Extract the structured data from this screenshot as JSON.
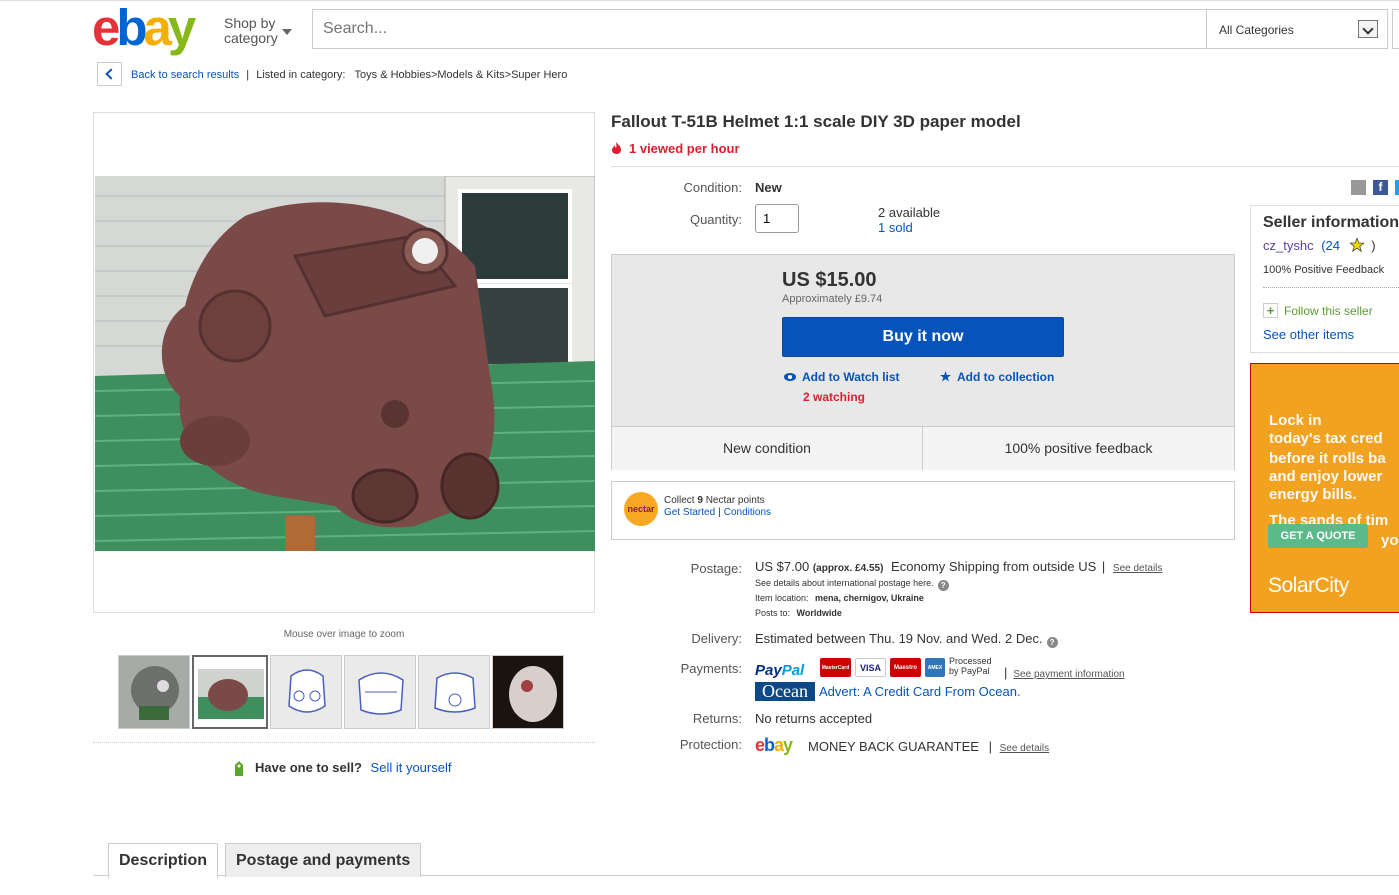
{
  "header": {
    "logo": {
      "e": "e",
      "b": "b",
      "a": "a",
      "y": "y"
    },
    "shop_by_line1": "Shop by",
    "shop_by_line2": "category",
    "search_placeholder": "Search...",
    "category_select": "All Categories"
  },
  "breadcrumb": {
    "back_label": "Back to search results",
    "sep": "|",
    "listed_label": "Listed in category:",
    "path": "Toys & Hobbies>Models & Kits>Super Hero"
  },
  "gallery": {
    "zoom_hint": "Mouse over image to zoom",
    "sell_question": "Have one to sell?",
    "sell_link": "Sell it yourself"
  },
  "item": {
    "title": "Fallout T-51B Helmet 1:1 scale DIY 3D paper model",
    "hot_text": "1 viewed per hour",
    "condition_label": "Condition:",
    "condition_value": "New",
    "quantity_label": "Quantity:",
    "quantity_value": "1",
    "available": "2 available",
    "sold": "1 sold"
  },
  "price_box": {
    "price": "US $15.00",
    "approx": "Approximately £9.74",
    "buy_label": "Buy it now",
    "watch_label": "Add to Watch list",
    "watching": "2 watching",
    "collection_label": "Add to collection",
    "feature_left": "New condition",
    "feature_right": "100% positive feedback"
  },
  "nectar": {
    "logo": "nectar",
    "collect_pre": "Collect ",
    "collect_num": "9",
    "collect_post": " Nectar points",
    "get_started": "Get Started",
    "sep": "|",
    "conditions": "Conditions"
  },
  "shipping": {
    "postage_label": "Postage:",
    "postage_price": "US $7.00",
    "postage_approx": "(approx. £4.55)",
    "postage_method": "Economy Shipping from outside US",
    "sep": "|",
    "see_details": "See details",
    "intl_note": "See details about international postage here.",
    "location_label": "Item location:",
    "location_value": "mena, chernigov, Ukraine",
    "posts_label": "Posts to:",
    "posts_value": "Worldwide",
    "delivery_label": "Delivery:",
    "delivery_value": "Estimated between Thu. 19 Nov. and Wed. 2 Dec.",
    "payments_label": "Payments:",
    "paypal_a": "Pay",
    "paypal_b": "Pal",
    "card_mastercard": "MasterCard",
    "card_visa": "VISA",
    "card_maestro": "Maestro",
    "card_amex": "AMEX",
    "processed_line1": "Processed",
    "processed_line2": "by PayPal",
    "see_payment": "See payment information",
    "ocean_logo": "Ocean",
    "ocean_text": "Advert: A Credit Card From Ocean.",
    "returns_label": "Returns:",
    "returns_value": "No returns accepted",
    "protection_label": "Protection:",
    "protection_value": "MONEY BACK GUARANTEE",
    "protection_details": "See details"
  },
  "seller": {
    "heading": "Seller information",
    "name": "cz_tyshc",
    "count": "24",
    "feedback": "100% Positive Feedback",
    "follow": "Follow this seller",
    "see_other": "See other items"
  },
  "ad": {
    "line1": "Lock in",
    "line2": "today's tax cred",
    "line3": "before it rolls ba",
    "line4": "and enjoy lower",
    "line5": "energy bills.",
    "line6": "The sands of tim",
    "line7": "you",
    "button": "GET A QUOTE",
    "brand": "SolarCity"
  },
  "tabs": {
    "description": "Description",
    "postage": "Postage and payments"
  },
  "colors": {
    "link": "#0654ba",
    "buy_button": "#0654ba",
    "alert": "#dd1e31",
    "ad_bg": "#f2a221"
  }
}
